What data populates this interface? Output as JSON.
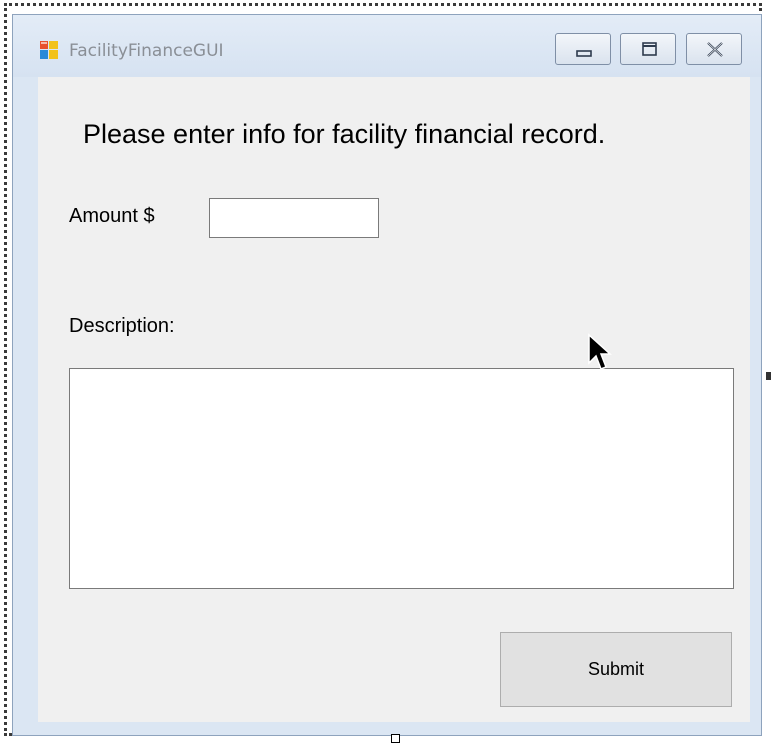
{
  "window": {
    "title": "FacilityFinanceGUI",
    "controls": [
      "minimize-icon",
      "maximize-icon",
      "close-icon"
    ]
  },
  "form": {
    "heading": "Please enter info for facility financial record.",
    "amount_label": "Amount $",
    "amount_value": "",
    "description_label": "Description:",
    "description_value": "",
    "submit_label": "Submit"
  },
  "colors": {
    "window_frame": "#dbe6f3",
    "client_background": "#f0f0f0",
    "button_background": "#e1e1e1",
    "title_text": "#8a8f96"
  }
}
